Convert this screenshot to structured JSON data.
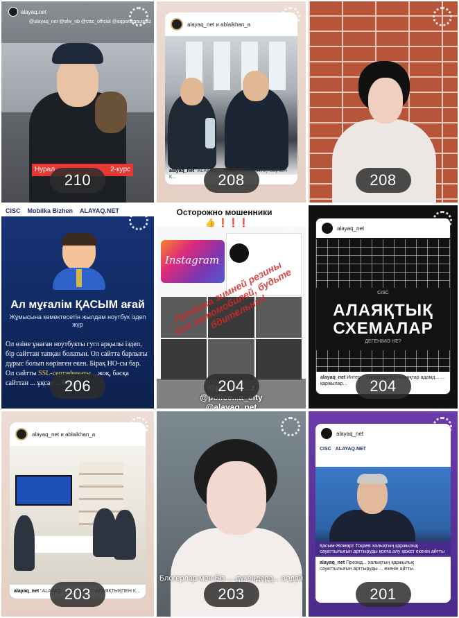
{
  "tiles": [
    {
      "views": "210",
      "top_handle": "alayaq.net",
      "mentions": "@alayaq_net @afw_nb @cisc_official @aqparatqauipsiz",
      "banner_left": "Нурал",
      "banner_right": "2-курс"
    },
    {
      "views": "208",
      "header": "alayaq_net и ablaikhan_a",
      "caption_user": "alayaq_net",
      "caption": "\"ALAYAQ ... ИНТЕРНЕТ-АЛАЯҚТЫҚПЕН К..."
    },
    {
      "views": "208"
    },
    {
      "views": "206",
      "logos": [
        "CISC",
        "Mobilka Bizhen",
        "ALAYAQ.NET"
      ],
      "title": "Ал мұғалім ҚАСЫМ ағай",
      "subtitle": "Жұмысына көмектесетін жылдам ноутбук іздеп жүр",
      "body_1": "Ол өзіне ұнаған ноутбукты гугл арқылы іздеп, бір сайттан тапқан болатын. Ол сайтта барлығы дұрыс болып көрінген екен. Бірақ НО-сы бар. Ол сайтты",
      "body_hl": "SSL-сертификаты",
      "body_2": "...жоқ, басқа сайттан ... ұқсас ... болды"
    },
    {
      "views": "204",
      "header": "Осторожно мошенники",
      "emoji": "👍 ❗❗❗",
      "instagram": "Instagram",
      "stamp": "Продажа зимней резины для автомобилей, будьте бдительны!",
      "footer_1": "@police_...z",
      "footer_2": "@police...a_city",
      "footer_3": "@alayaq_net"
    },
    {
      "views": "204",
      "header": "alayaq_net",
      "brand": "CISC",
      "big": "АЛАЯҚТЫҚ СХЕМАЛАР",
      "small": "ДЕГЕНІМІЗ НЕ?",
      "caption_user": "alayaq_net",
      "caption": "Интер... схемалар-бұл алаяқтар адамд... ... қаржылар..."
    },
    {
      "views": "203",
      "header": "alayaq_net и ablaikhan_a",
      "caption_user": "alayaq_net",
      "caption": "\"ALAYAQ ... ИНТЕРНЕТ-АЛАЯҚТЫҚПЕН К..."
    },
    {
      "views": "203",
      "subtitle": "Блогерлар мен Біз ... дүкендерд... алдай"
    },
    {
      "views": "201",
      "header": "alayaq_net",
      "logos": [
        "CISC",
        "ALAYAQ.NET"
      ],
      "band": "Қасым-Жомарт Тоқаев халықтың қаржылық сауаттылығын арттыруды қолға алу қажет екенін айтты",
      "caption_user": "alayaq_net",
      "caption": "Презид... халықтың қаржылық сауаттылығын арттыруды ... екенін айтты."
    }
  ]
}
